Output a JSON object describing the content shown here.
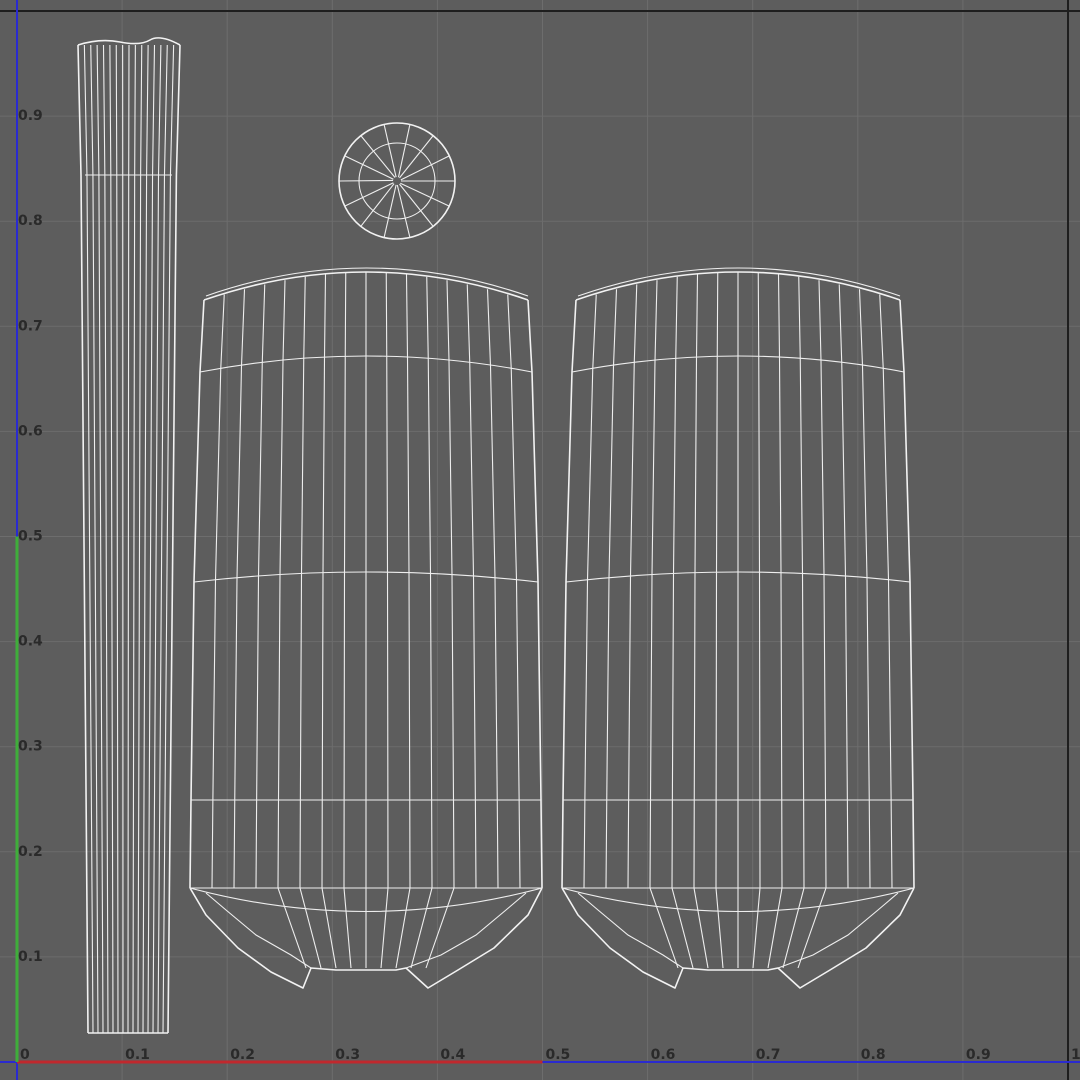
{
  "viewport": {
    "axes": {
      "u_tick_labels": [
        "0",
        "0.1",
        "0.2",
        "0.3",
        "0.4",
        "0.5",
        "0.6",
        "0.7",
        "0.8",
        "0.9",
        "1"
      ],
      "v_tick_labels": [
        "0.1",
        "0.2",
        "0.3",
        "0.4",
        "0.5",
        "0.6",
        "0.7",
        "0.8",
        "0.9"
      ],
      "u_axis_color": "#c0282d",
      "v_axis_color": "#3fae3a",
      "frame_color": "#2a2ad0"
    },
    "colors": {
      "background": "#5d5d5d",
      "grid": "#6d6d6d",
      "wireframe": "#f2f2f2"
    },
    "grid": true,
    "islands": [
      "strip-island",
      "cap-island",
      "body-island-left",
      "body-island-right"
    ]
  }
}
